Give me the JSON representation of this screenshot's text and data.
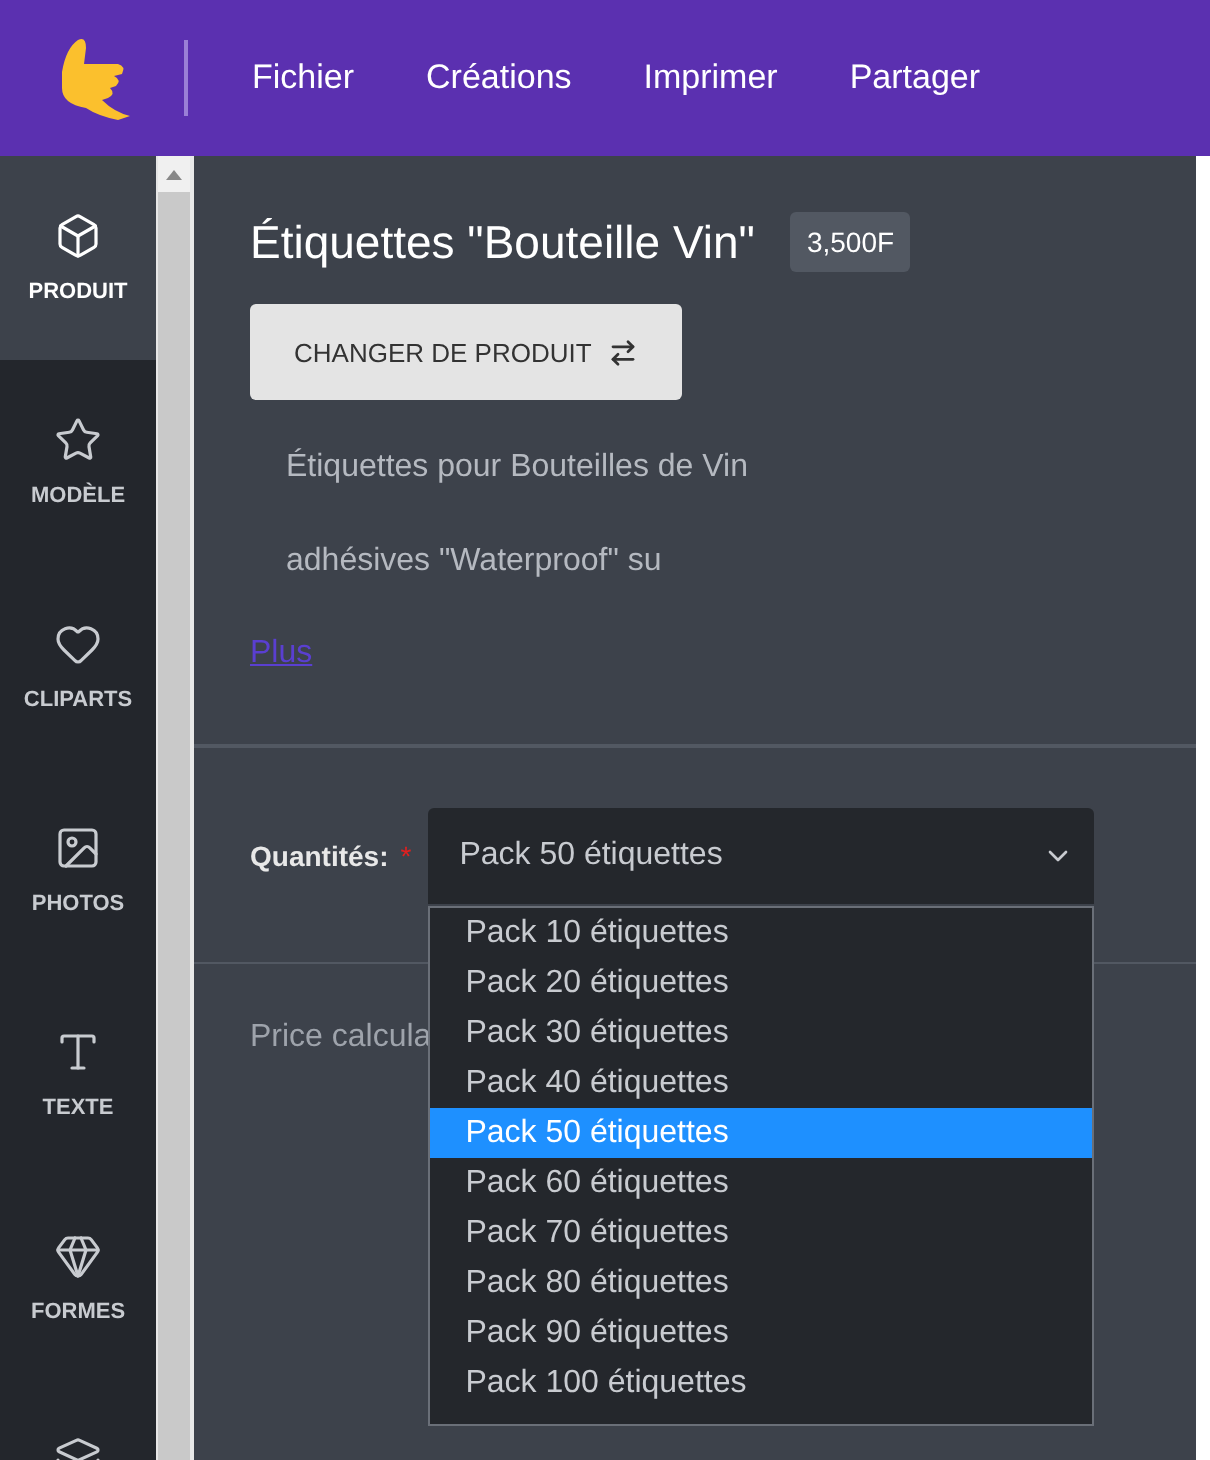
{
  "menu_bar": {
    "items": [
      "Fichier",
      "Créations",
      "Imprimer",
      "Partager"
    ]
  },
  "sidebar": {
    "items": [
      {
        "kind": "box",
        "label": "PRODUIT",
        "selected": true
      },
      {
        "kind": "star",
        "label": "MODÈLE",
        "selected": false
      },
      {
        "kind": "heart",
        "label": "CLIPARTS",
        "selected": false
      },
      {
        "kind": "image",
        "label": "PHOTOS",
        "selected": false
      },
      {
        "kind": "text",
        "label": "TEXTE",
        "selected": false
      },
      {
        "kind": "gem",
        "label": "FORMES",
        "selected": false
      },
      {
        "kind": "layers",
        "selected": false
      }
    ]
  },
  "product": {
    "title": "Étiquettes \"Bouteille Vin\"",
    "price": "3,500F",
    "change_button": "CHANGER DE PRODUIT",
    "description": [
      "Étiquettes pour Bouteilles de Vin",
      "adhésives \"Waterproof\" su"
    ],
    "more_link": "Plus"
  },
  "quantity": {
    "label": "Quantités:",
    "required_mark": "*",
    "value": "Pack 50 étiquettes",
    "expanded": true,
    "options": [
      {
        "label": "Pack 10 étiquettes",
        "selected": false
      },
      {
        "label": "Pack 20 étiquettes",
        "selected": false
      },
      {
        "label": "Pack 30 étiquettes",
        "selected": false
      },
      {
        "label": "Pack 40 étiquettes",
        "selected": false
      },
      {
        "label": "Pack 50 étiquettes",
        "selected": true
      },
      {
        "label": "Pack 60 étiquettes",
        "selected": false
      },
      {
        "label": "Pack 70 étiquettes",
        "selected": false
      },
      {
        "label": "Pack 80 étiquettes",
        "selected": false
      },
      {
        "label": "Pack 90 étiquettes",
        "selected": false
      },
      {
        "label": "Pack 100 étiquettes",
        "selected": false
      }
    ]
  },
  "price_section": {
    "text": "Price calcula"
  }
}
